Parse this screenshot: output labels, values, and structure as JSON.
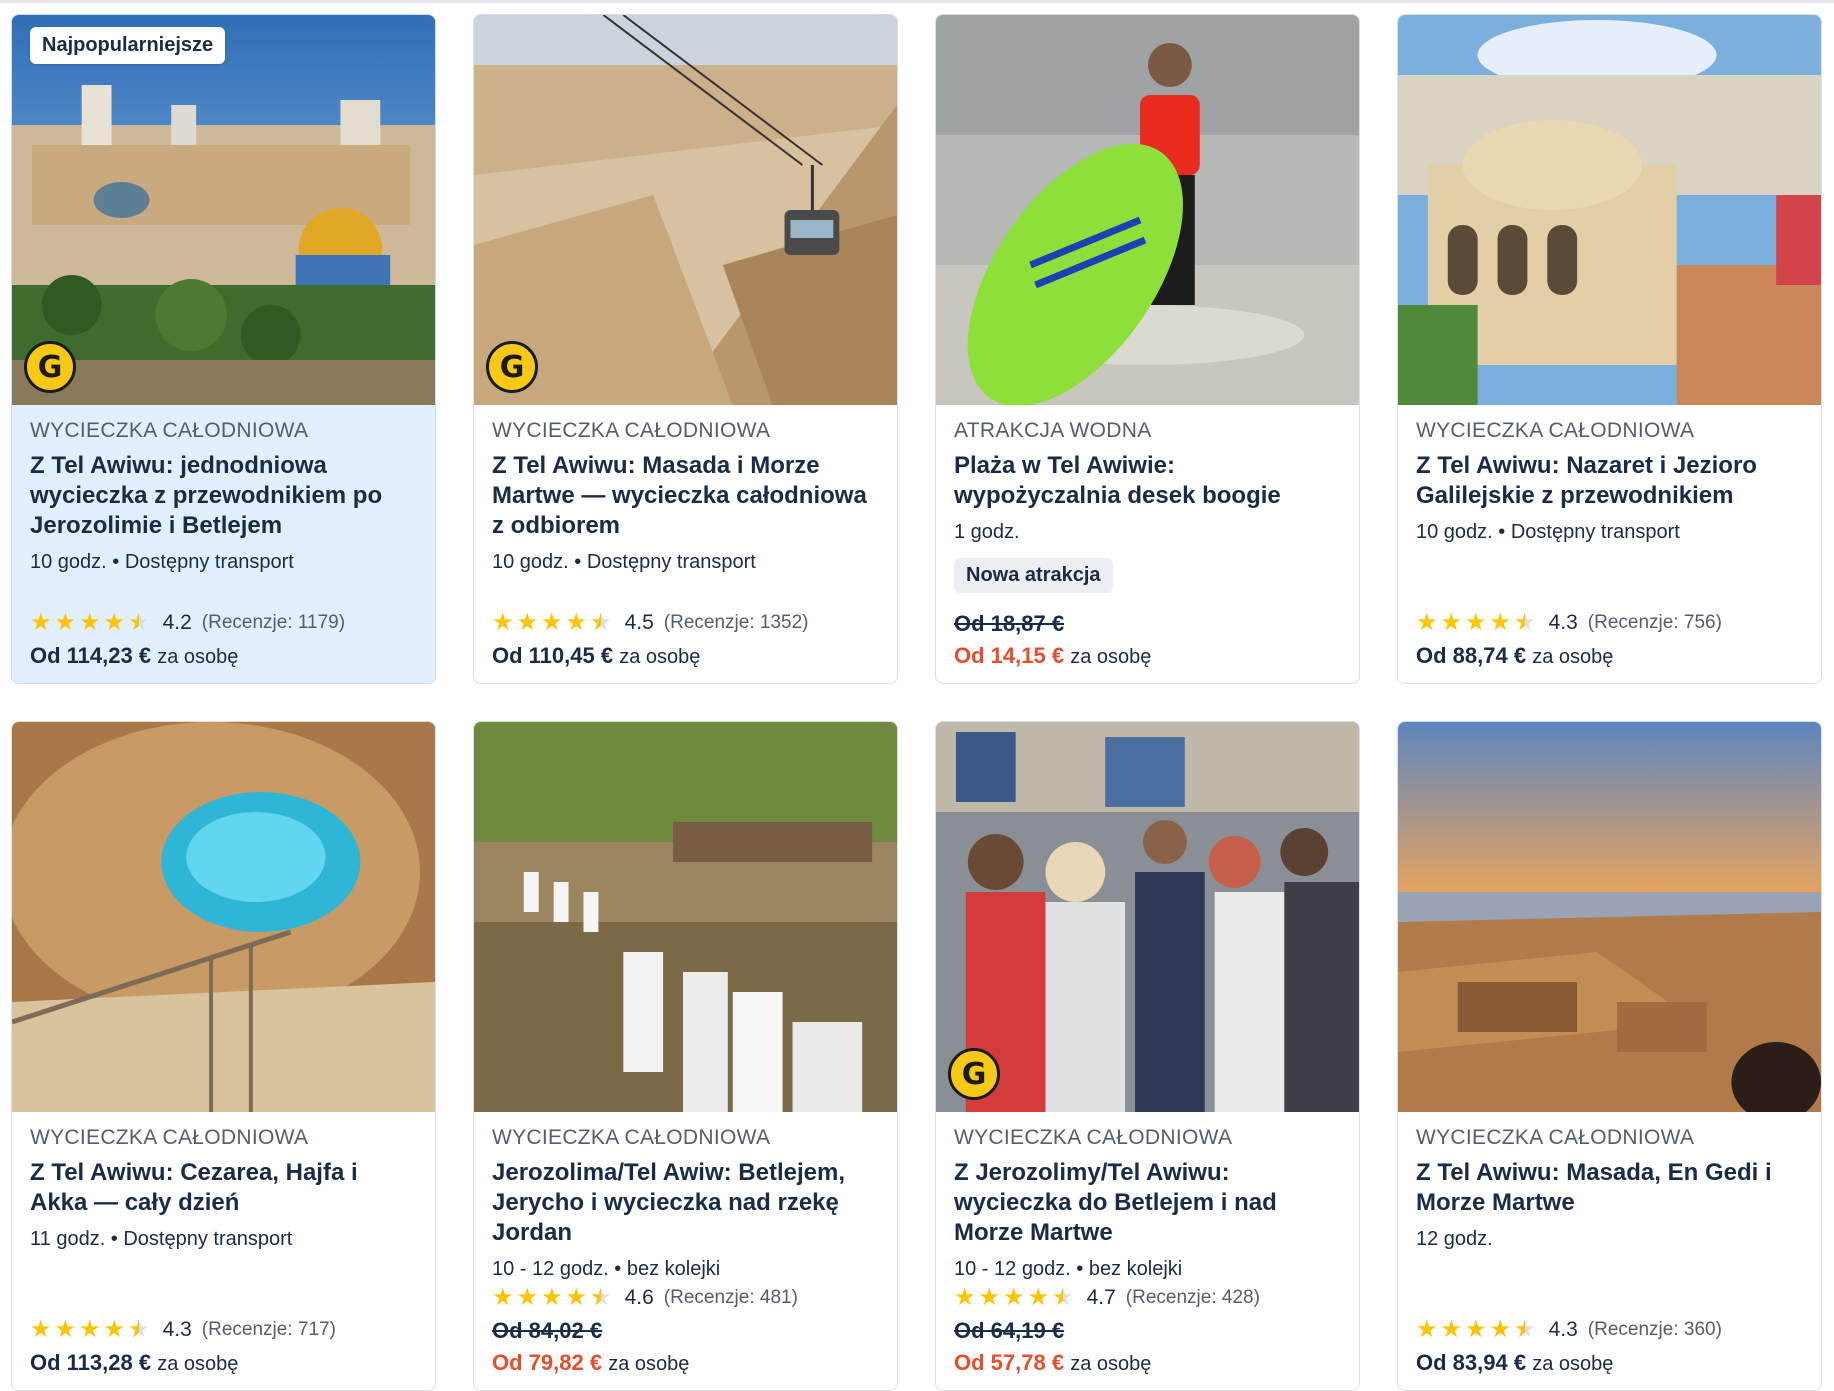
{
  "cards": [
    {
      "badge": "Najpopularniejsze",
      "category": "WYCIECZKA CAŁODNIOWA",
      "title": "Z Tel Awiwu: jednodniowa wycieczka z przewodnikiem po Jerozolimie i Betlejem",
      "meta": "10 godz. • Dostępny transport",
      "rating": "4.2",
      "reviews": "(Recenzje: 1179)",
      "old_price": "",
      "price": "Od 114,23 €",
      "per": "za osobę",
      "new_tag": ""
    },
    {
      "badge": "",
      "category": "WYCIECZKA CAŁODNIOWA",
      "title": "Z Tel Awiwu: Masada i Morze Martwe — wycieczka całodniowa z odbiorem",
      "meta": "10 godz. • Dostępny transport",
      "rating": "4.5",
      "reviews": "(Recenzje: 1352)",
      "old_price": "",
      "price": "Od 110,45 €",
      "per": "za osobę",
      "new_tag": ""
    },
    {
      "badge": "",
      "category": "ATRAKCJA WODNA",
      "title": "Plaża w Tel Awiwie: wypożyczalnia desek boogie",
      "meta": "1 godz.",
      "rating": "",
      "reviews": "",
      "old_price": "Od 18,87 €",
      "price": "Od 14,15 €",
      "per": "za osobę",
      "new_tag": "Nowa atrakcja"
    },
    {
      "badge": "",
      "category": "WYCIECZKA CAŁODNIOWA",
      "title": "Z Tel Awiwu: Nazaret i Jezioro Galilejskie z przewodnikiem",
      "meta": "10 godz. • Dostępny transport",
      "rating": "4.3",
      "reviews": "(Recenzje: 756)",
      "old_price": "",
      "price": "Od 88,74 €",
      "per": "za osobę",
      "new_tag": ""
    },
    {
      "badge": "",
      "category": "WYCIECZKA CAŁODNIOWA",
      "title": "Z Tel Awiwu: Cezarea, Hajfa i Akka — cały dzień",
      "meta": "11 godz. • Dostępny transport",
      "rating": "4.3",
      "reviews": "(Recenzje: 717)",
      "old_price": "",
      "price": "Od 113,28 €",
      "per": "za osobę",
      "new_tag": ""
    },
    {
      "badge": "",
      "category": "WYCIECZKA CAŁODNIOWA",
      "title": "Jerozolima/Tel Awiw: Betlejem, Jerycho i wycieczka nad rzekę Jordan",
      "meta": "10 - 12 godz. • bez kolejki",
      "rating": "4.6",
      "reviews": "(Recenzje: 481)",
      "old_price": "Od 84,02 €",
      "price": "Od 79,82 €",
      "per": "za osobę",
      "new_tag": ""
    },
    {
      "badge": "",
      "category": "WYCIECZKA CAŁODNIOWA",
      "title": "Z Jerozolimy/Tel Awiwu: wycieczka do Betlejem i nad Morze Martwe",
      "meta": "10 - 12 godz. • bez kolejki",
      "rating": "4.7",
      "reviews": "(Recenzje: 428)",
      "old_price": "Od 64,19 €",
      "price": "Od 57,78 €",
      "per": "za osobę",
      "new_tag": ""
    },
    {
      "badge": "",
      "category": "WYCIECZKA CAŁODNIOWA",
      "title": "Z Tel Awiwu: Masada, En Gedi i Morze Martwe",
      "meta": "12 godz.",
      "rating": "4.3",
      "reviews": "(Recenzje: 360)",
      "old_price": "",
      "price": "Od 83,94 €",
      "per": "za osobę",
      "new_tag": ""
    }
  ],
  "g_badge_letter": "G",
  "colors": {
    "sale": "#eb4c2c",
    "star": "#fdc500",
    "highlight": "#e1efff",
    "text": "#1a2b49"
  }
}
